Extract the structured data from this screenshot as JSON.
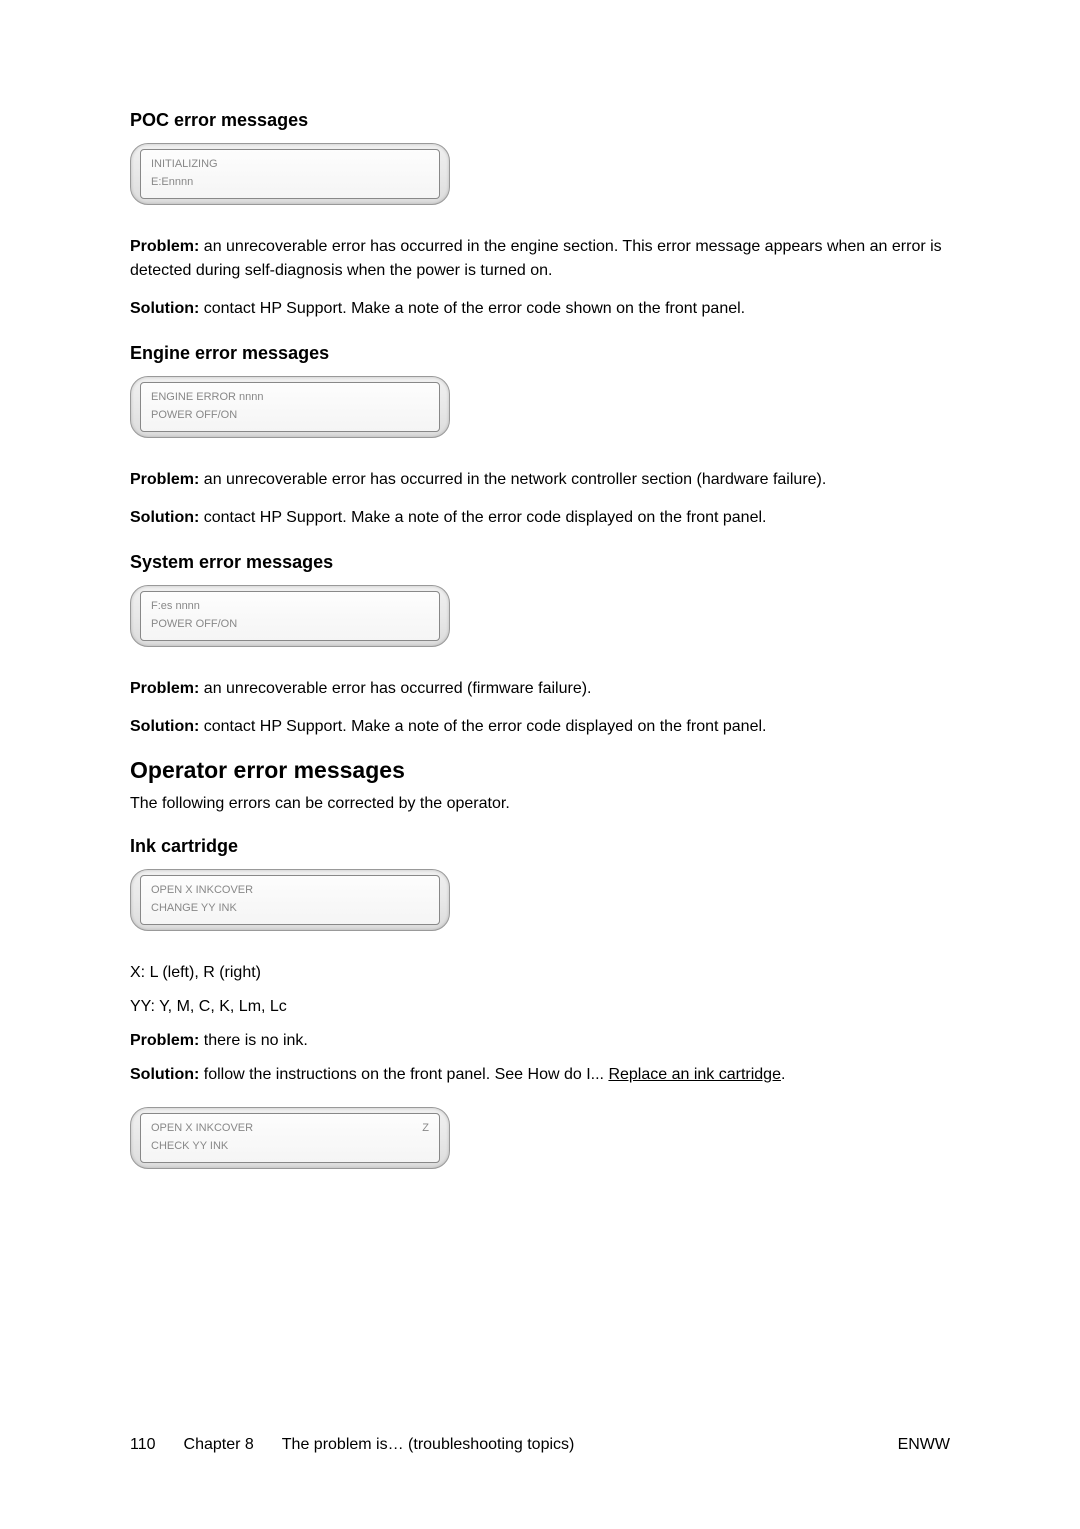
{
  "sections": {
    "poc": {
      "heading": "POC error messages",
      "lcd": {
        "line1": "INITIALIZING",
        "line2": "E:Ennnn"
      },
      "problem_label": "Problem:",
      "problem_text": " an unrecoverable error has occurred in the engine section. This error message appears when an error is detected during self-diagnosis when the power is turned on.",
      "solution_label": "Solution:",
      "solution_text": " contact HP Support. Make a note of the error code shown on the front panel."
    },
    "engine": {
      "heading": "Engine error messages",
      "lcd": {
        "line1": "ENGINE ERROR nnnn",
        "line2": "POWER OFF/ON"
      },
      "problem_label": "Problem:",
      "problem_text": " an unrecoverable error has occurred in the network controller section (hardware failure).",
      "solution_label": "Solution:",
      "solution_text": " contact HP Support. Make a note of the error code displayed on the front panel."
    },
    "system": {
      "heading": "System error messages",
      "lcd": {
        "line1": "F:es  nnnn",
        "line2": "POWER OFF/ON"
      },
      "problem_label": "Problem:",
      "problem_text": " an unrecoverable error has occurred (firmware failure).",
      "solution_label": "Solution:",
      "solution_text": " contact HP Support. Make a note of the error code displayed on the front panel."
    },
    "operator": {
      "heading": "Operator error messages",
      "intro": "The following errors can be corrected by the operator."
    },
    "ink": {
      "heading": "Ink cartridge",
      "lcd1": {
        "line1": "OPEN X INKCOVER",
        "line2": "CHANGE YY INK"
      },
      "x_label": "X: L (left), R (right)",
      "yy_label": "YY: Y, M, C, K, Lm, Lc",
      "problem_label": "Problem:",
      "problem_text": " there is no ink.",
      "solution_label": "Solution:",
      "solution_text_before": " follow the instructions on the front panel. See How do I... ",
      "solution_link": "Replace an ink cartridge",
      "solution_text_after": ".",
      "lcd2": {
        "line1": "OPEN X INKCOVER",
        "line1_right": "Z",
        "line2": "CHECK YY INK"
      }
    }
  },
  "footer": {
    "page_number": "110",
    "chapter": "Chapter 8",
    "chapter_title": "The problem is… (troubleshooting topics)",
    "right": "ENWW"
  }
}
